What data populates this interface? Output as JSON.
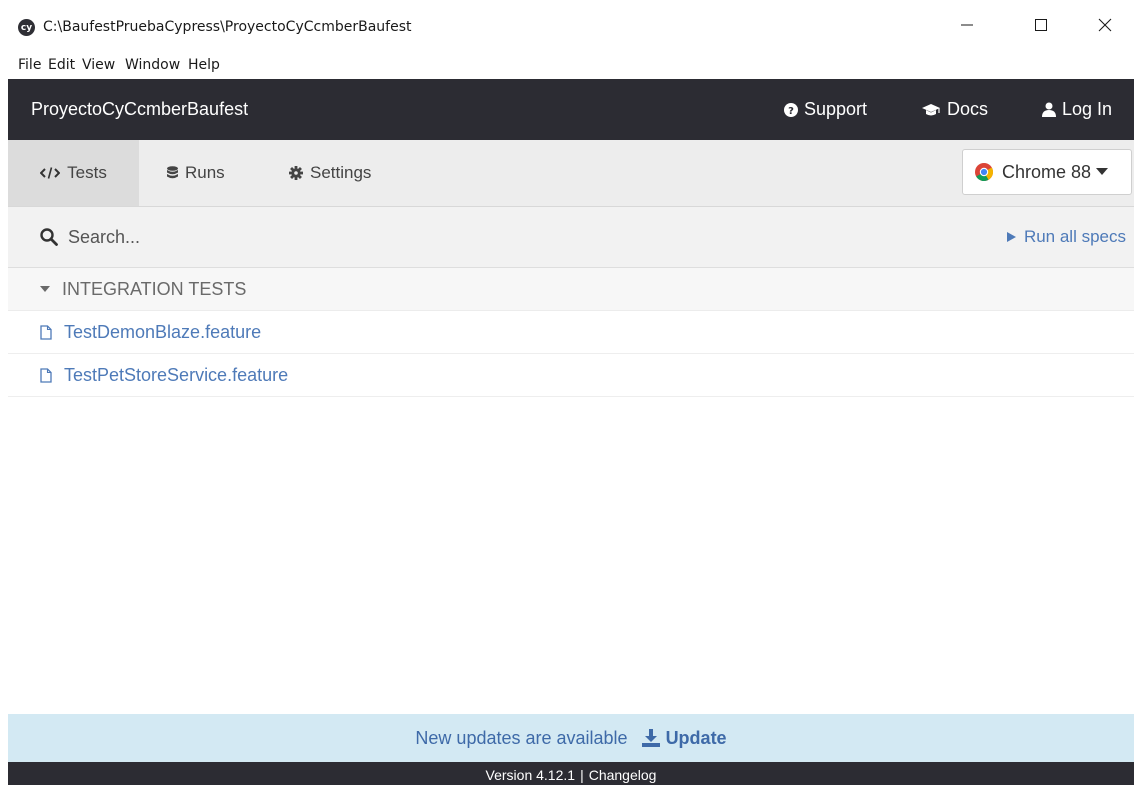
{
  "window": {
    "title": "C:\\BaufestPruebaCypress\\ProyectoCyCcmberBaufest",
    "app_icon_text": "cy"
  },
  "menu": {
    "items": [
      "File",
      "Edit",
      "View",
      "Window",
      "Help"
    ]
  },
  "header": {
    "project": "ProyectoCyCcmberBaufest",
    "support": "Support",
    "docs": "Docs",
    "login": "Log In"
  },
  "tabs": {
    "tests": "Tests",
    "runs": "Runs",
    "settings": "Settings",
    "active": "tests"
  },
  "browser": {
    "selected": "Chrome 88",
    "icon": "chrome-icon"
  },
  "search": {
    "placeholder": "Search...",
    "value": ""
  },
  "run_all": "Run all specs",
  "specs": {
    "group": "INTEGRATION TESTS",
    "files": [
      "TestDemonBlaze.feature",
      "TestPetStoreService.feature"
    ]
  },
  "update_banner": {
    "message": "New updates are available",
    "action": "Update"
  },
  "footer": {
    "version": "Version 4.12.1",
    "separator": "|",
    "changelog": "Changelog"
  },
  "colors": {
    "header_bg": "#2c2c33",
    "link_blue": "#4e7ab8",
    "banner_bg": "#d3e9f3"
  }
}
